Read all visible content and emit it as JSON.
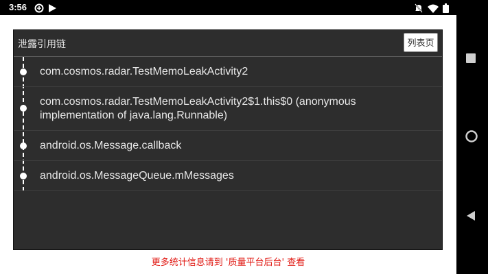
{
  "status_bar": {
    "time": "3:56",
    "left_icons": [
      "data-saver-icon",
      "play-store-icon"
    ],
    "right_icons": [
      "notifications-off-icon",
      "wifi-icon",
      "battery-icon"
    ]
  },
  "panel": {
    "title": "泄露引用链",
    "list_page_button": "列表页",
    "chain": [
      "com.cosmos.radar.TestMemoLeakActivity2",
      "com.cosmos.radar.TestMemoLeakActivity2$1.this$0  (anonymous implementation of java.lang.Runnable)",
      "android.os.Message.callback",
      "android.os.MessageQueue.mMessages"
    ]
  },
  "footer_note": "更多统计信息请到 '质量平台后台' 查看",
  "colors": {
    "panel_background": "#2d2d2d",
    "footer_text": "#e0140e"
  },
  "nav_bar": {
    "buttons": [
      "recents-icon",
      "home-icon",
      "back-icon"
    ]
  }
}
